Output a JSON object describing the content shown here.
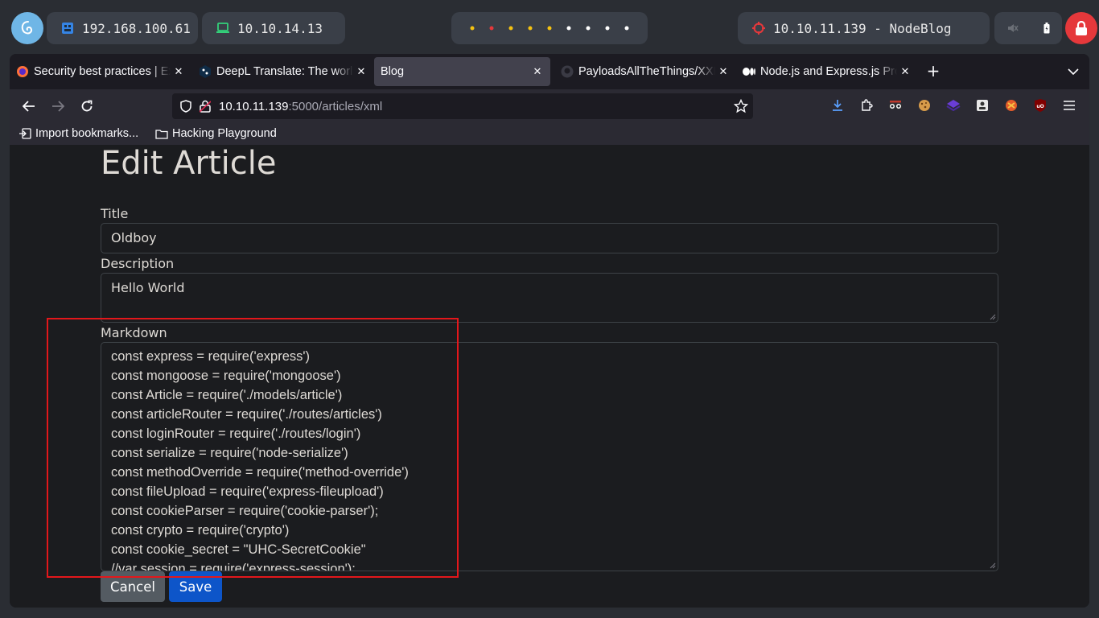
{
  "desktop_bar": {
    "ip_local": "192.168.100.61",
    "ip_vpn": "10.10.14.13",
    "target": "10.10.11.139 - NodeBlog",
    "workspace_colors": [
      "#f5c211",
      "#e5383b",
      "#f5c211",
      "#f5c211",
      "#f5c211",
      "#ffffff",
      "#ffffff",
      "#ffffff",
      "#ffffff"
    ]
  },
  "browser": {
    "tabs": [
      {
        "title": "Security best practices | Express",
        "icon": "firefox-icon",
        "active": false
      },
      {
        "title": "DeepL Translate: The world's most accurate translator",
        "icon": "deepl-icon",
        "active": false
      },
      {
        "title": "Blog",
        "icon": "",
        "active": true
      },
      {
        "title": "PayloadsAllTheThings/XXE Injection",
        "icon": "github-icon",
        "active": false
      },
      {
        "title": "Node.js and Express.js Pro tips",
        "icon": "medium-icon",
        "active": false
      }
    ],
    "url": {
      "host": "10.10.11.139",
      "path": ":5000/articles/xml"
    },
    "bookmarks": [
      {
        "label": "Import bookmarks..."
      },
      {
        "label": "Hacking Playground"
      }
    ]
  },
  "page": {
    "heading": "Edit Article",
    "title_label": "Title",
    "title_value": "Oldboy",
    "description_label": "Description",
    "description_value": "Hello World",
    "markdown_label": "Markdown",
    "markdown_lines": [
      "const express = require('express')",
      "const mongoose = require('mongoose')",
      "const Article = require('./models/article')",
      "const articleRouter = require('./routes/articles')",
      "const loginRouter = require('./routes/login')",
      "const serialize = require('node-serialize')",
      "const methodOverride = require('method-override')",
      "const fileUpload = require('express-fileupload')",
      "const cookieParser = require('cookie-parser');",
      "const crypto = require('crypto')",
      "const cookie_secret = \"UHC-SecretCookie\"",
      "//var session = require('express-session');"
    ],
    "cancel_label": "Cancel",
    "save_label": "Save",
    "colors": {
      "save_button": "#0d55c9",
      "cancel_button": "#545b62",
      "highlight_box": "#e3171b"
    }
  }
}
